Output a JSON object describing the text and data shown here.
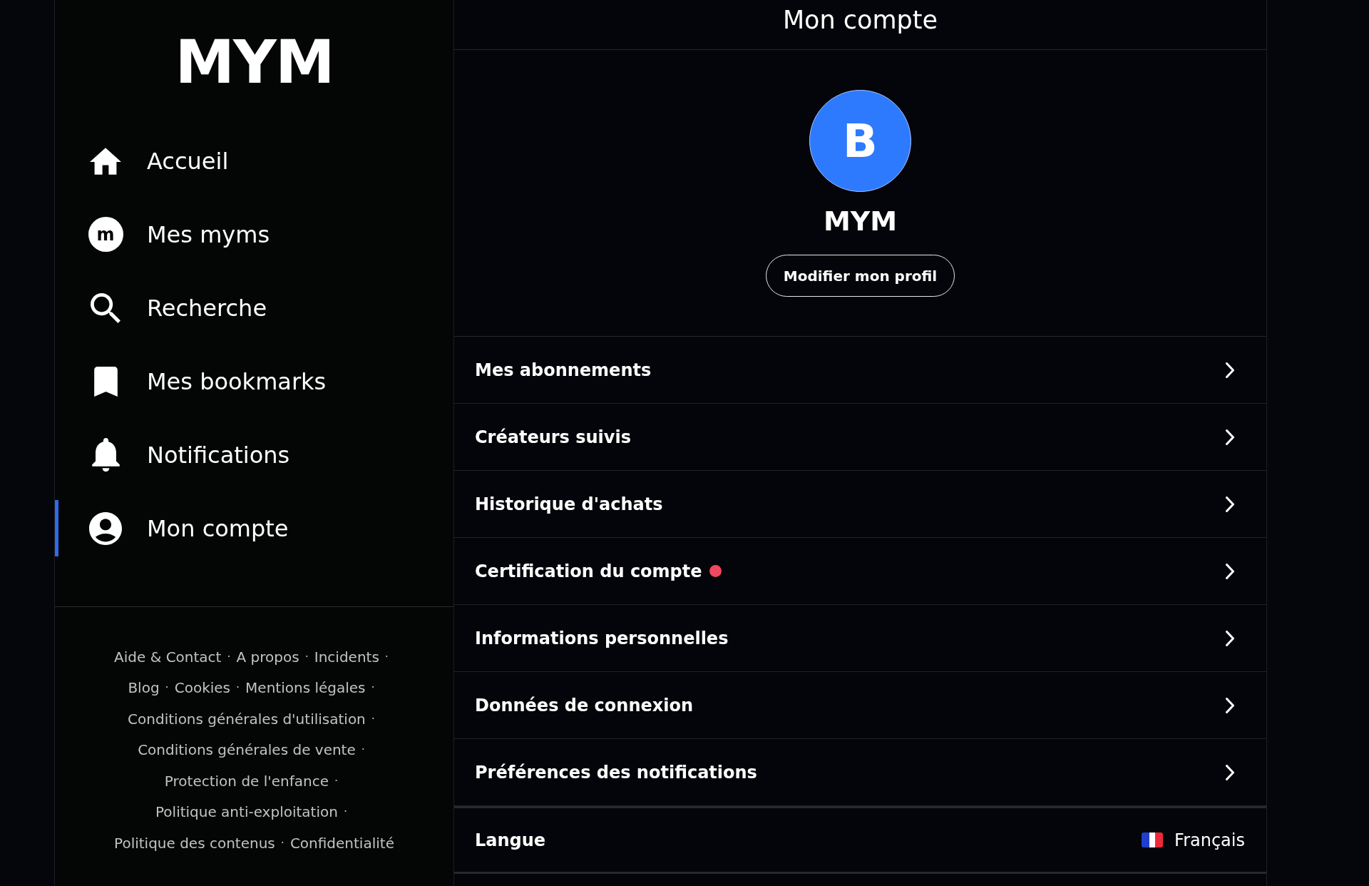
{
  "sidebar": {
    "logo": "MYM",
    "items": [
      {
        "label": "Accueil",
        "selected": false
      },
      {
        "label": "Mes myms",
        "icon_letter": "m",
        "selected": false
      },
      {
        "label": "Recherche",
        "selected": false
      },
      {
        "label": "Mes bookmarks",
        "selected": false
      },
      {
        "label": "Notifications",
        "selected": false
      },
      {
        "label": "Mon compte",
        "selected": true
      }
    ],
    "footer": {
      "separator": "·",
      "lines": [
        [
          "Aide & Contact",
          "A propos",
          "Incidents"
        ],
        [
          "Blog",
          "Cookies",
          "Mentions légales"
        ],
        [
          "Conditions générales d'utilisation"
        ],
        [
          "Conditions générales de vente"
        ],
        [
          "Protection de l'enfance"
        ],
        [
          "Politique anti-exploitation"
        ],
        [
          "Politique des contenus",
          "Confidentialité"
        ]
      ]
    }
  },
  "main": {
    "title": "Mon compte",
    "profile": {
      "avatar_initial": "B",
      "name": "MYM",
      "edit_button": "Modifier mon profil"
    },
    "menu": [
      {
        "kind": "link",
        "label": "Mes abonnements",
        "notice": false
      },
      {
        "kind": "link",
        "label": "Créateurs suivis",
        "notice": false
      },
      {
        "kind": "link",
        "label": "Historique d'achats",
        "notice": false
      },
      {
        "kind": "link",
        "label": "Certification du compte",
        "notice": true
      },
      {
        "kind": "link",
        "label": "Informations personnelles",
        "notice": false
      },
      {
        "kind": "link",
        "label": "Données de connexion",
        "notice": false
      },
      {
        "kind": "link",
        "label": "Préférences des notifications",
        "notice": false
      },
      {
        "kind": "setting",
        "label": "Langue",
        "value": "Français",
        "notice": false
      }
    ]
  }
}
